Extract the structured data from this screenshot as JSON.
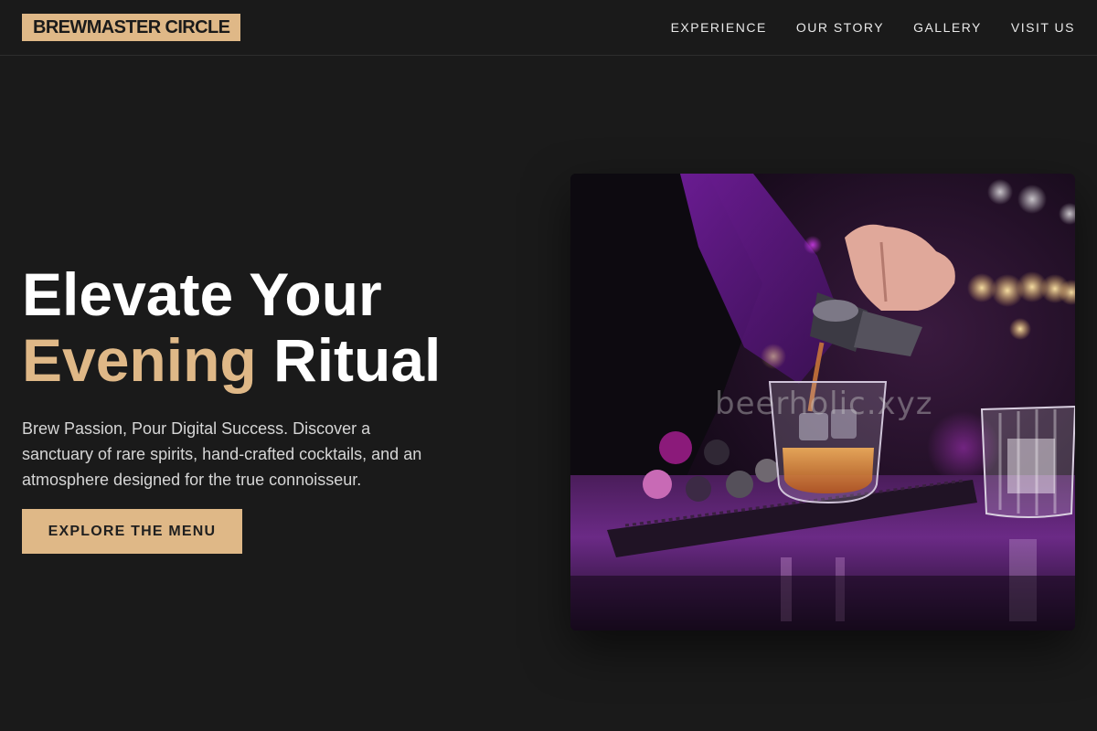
{
  "brand": {
    "logo_text": "BREWMASTER CIRCLE",
    "accent_color": "#dfb887",
    "background_color": "#1a1a1a"
  },
  "nav": {
    "items": [
      {
        "label": "EXPERIENCE"
      },
      {
        "label": "OUR STORY"
      },
      {
        "label": "GALLERY"
      },
      {
        "label": "VISIT US"
      }
    ]
  },
  "hero": {
    "title_line1": "Elevate Your",
    "title_accent": "Evening",
    "title_line2_rest": " Ritual",
    "description": "Brew Passion, Pour Digital Success. Discover a sanctuary of rare spirits, hand-crafted cocktails, and an atmosphere designed for the true connoisseur.",
    "cta_label": "EXPLORE THE MENU",
    "image": {
      "watermark": "beerholic.xyz"
    }
  }
}
